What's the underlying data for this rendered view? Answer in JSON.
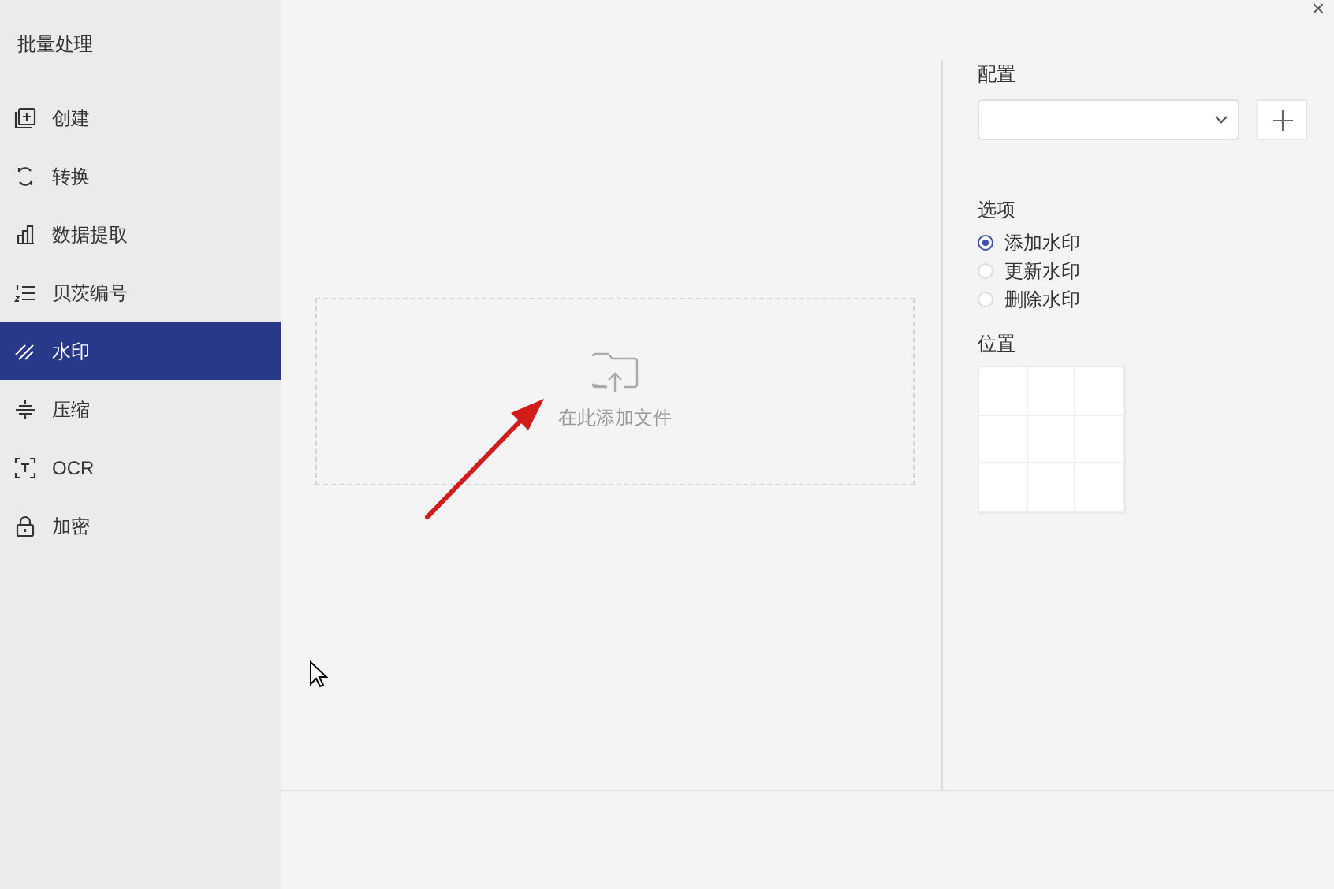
{
  "window": {
    "close": "×"
  },
  "sidebar": {
    "title": "批量处理",
    "items": [
      {
        "label": "创建",
        "kind": "create",
        "selected": false
      },
      {
        "label": "转换",
        "kind": "convert",
        "selected": false
      },
      {
        "label": "数据提取",
        "kind": "extract",
        "selected": false
      },
      {
        "label": "贝茨编号",
        "kind": "number",
        "selected": false
      },
      {
        "label": "水印",
        "kind": "watermark",
        "selected": true
      },
      {
        "label": "压缩",
        "kind": "compress",
        "selected": false
      },
      {
        "label": "OCR",
        "kind": "ocr",
        "selected": false
      },
      {
        "label": "加密",
        "kind": "lock",
        "selected": false
      }
    ]
  },
  "dropzone": {
    "text": "在此添加文件"
  },
  "settings": {
    "config_label": "配置",
    "options_label": "选项",
    "options": [
      {
        "label": "添加水印",
        "selected": true
      },
      {
        "label": "更新水印",
        "selected": false
      },
      {
        "label": "删除水印",
        "selected": false
      }
    ],
    "position_label": "位置"
  }
}
